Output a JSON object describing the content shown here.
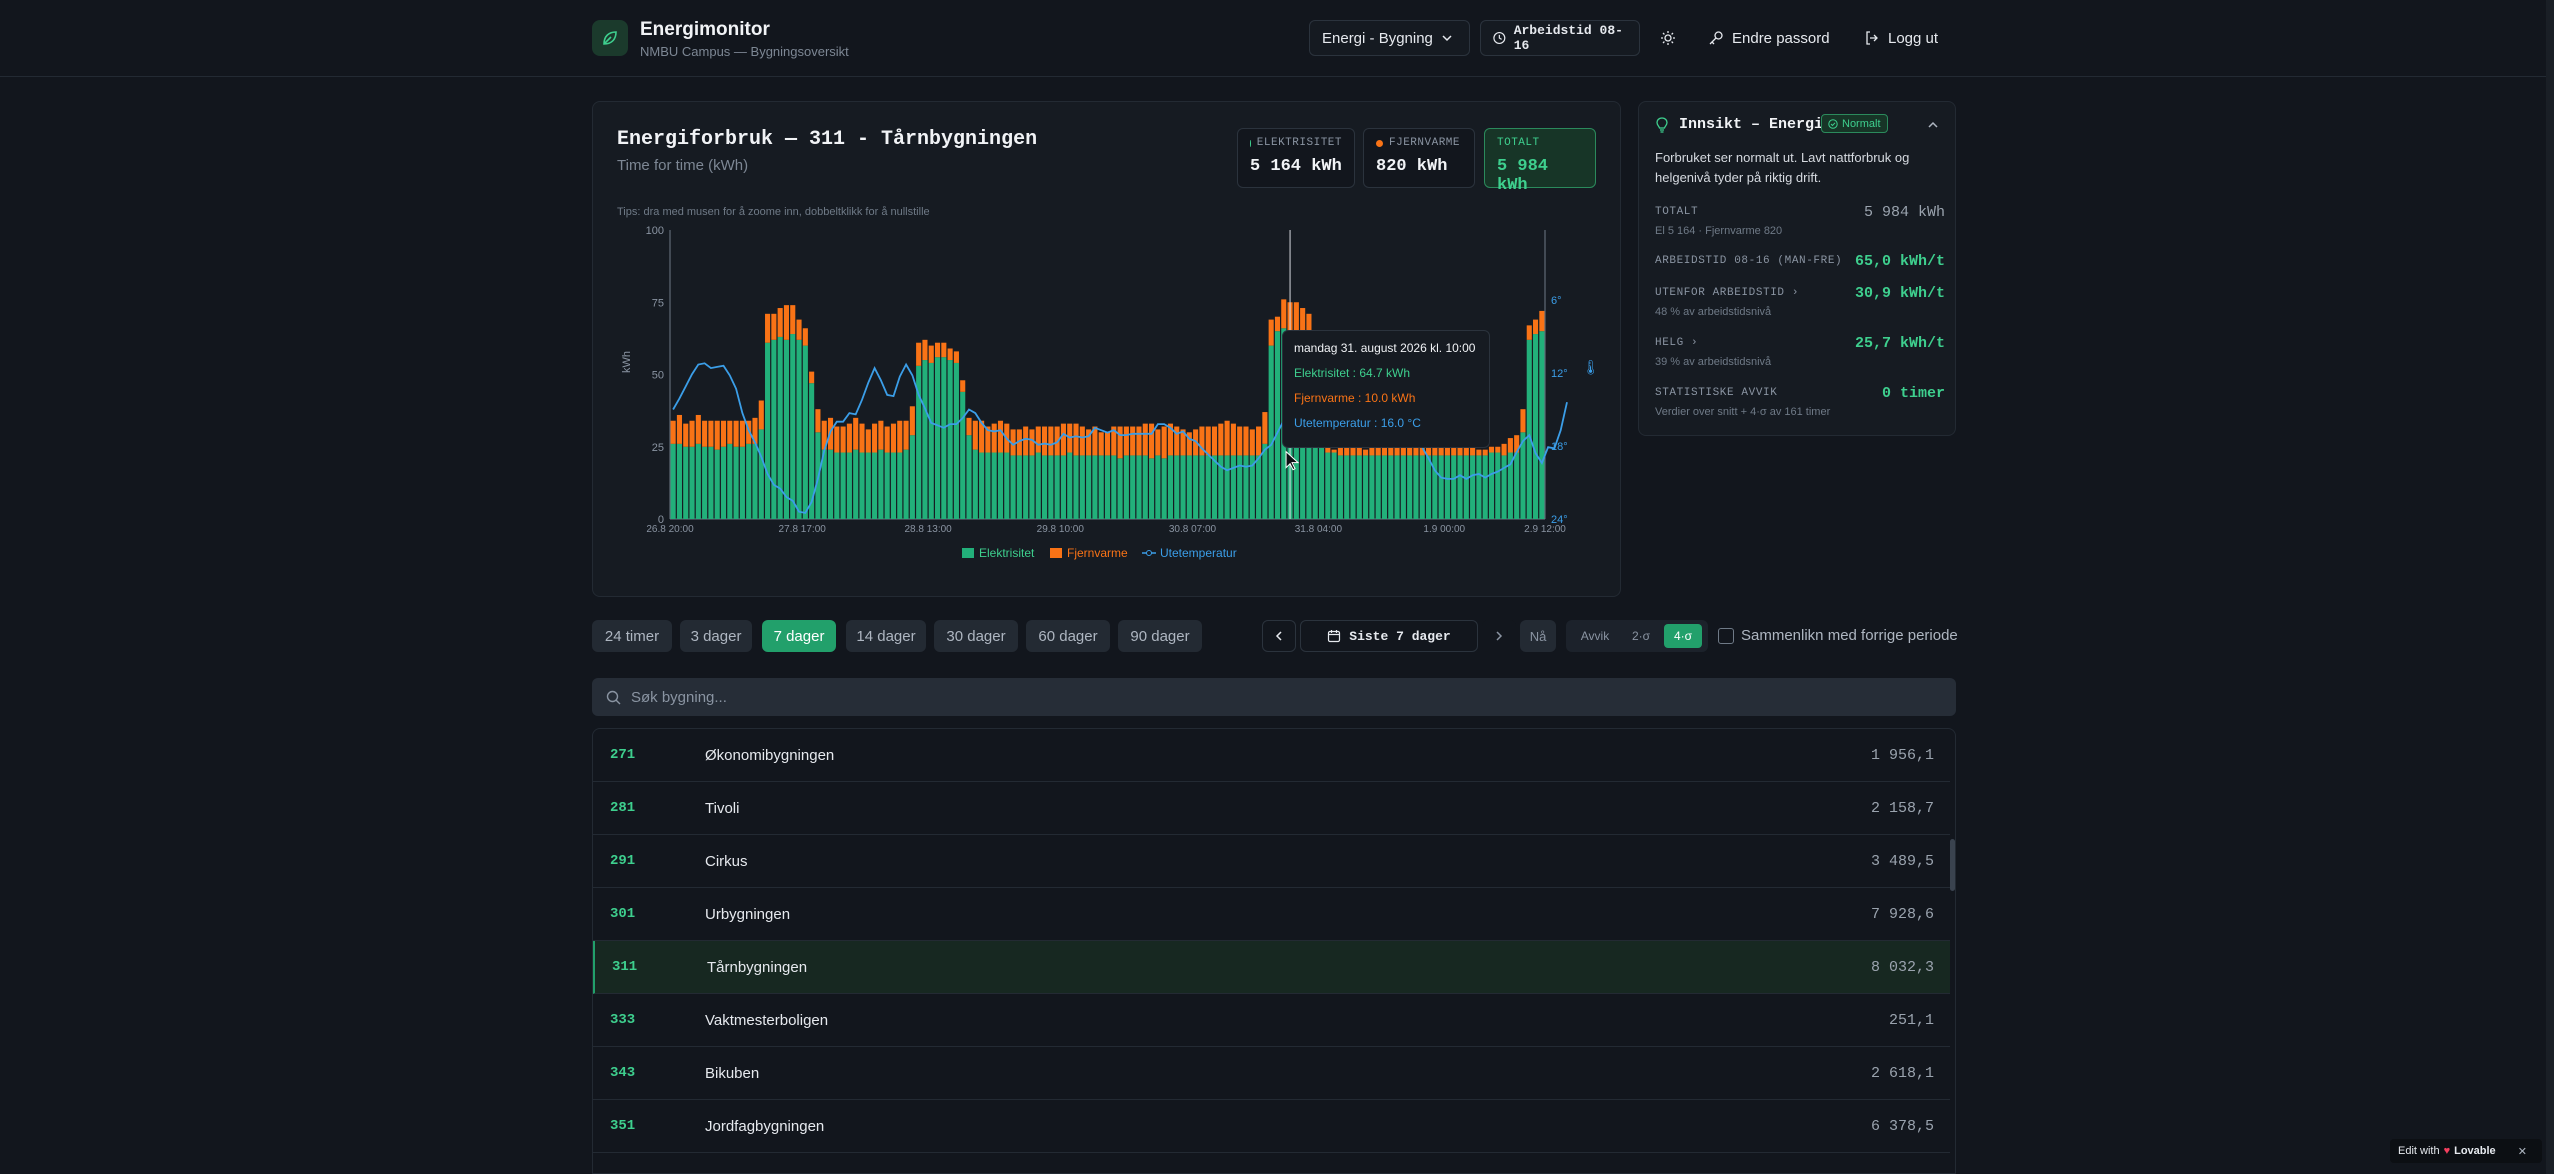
{
  "app": {
    "title": "Energimonitor",
    "subtitle": "NMBU Campus — Bygningsoversikt"
  },
  "header": {
    "view_select": "Energi - Bygning",
    "worktime": "Arbeidstid 08-16",
    "change_password": "Endre passord",
    "logout": "Logg ut"
  },
  "chart_card": {
    "title": "Energiforbruk — 311 - Tårnbygningen",
    "subtitle": "Time for time (kWh)",
    "tip": "Tips: dra med musen for å zoome inn, dobbeltklikk for å nullstille",
    "kpis": [
      {
        "label": "ELEKTRISITET",
        "value": "5 164 kWh",
        "color": "#3ecf8e"
      },
      {
        "label": "FJERNVARME",
        "value": "820 kWh",
        "color": "#f97316"
      },
      {
        "label": "TOTALT",
        "value": "5 984 kWh",
        "color": "#3ecf8e"
      }
    ]
  },
  "tooltip": {
    "title": "mandag 31. august 2026 kl. 10:00",
    "el": "Elektrisitet : 64.7 kWh",
    "fv": "Fjernvarme : 10.0 kWh",
    "temp": "Utetemperatur : 16.0 °C"
  },
  "chart_data": {
    "type": "bar",
    "ylabel": "kWh",
    "ylim": [
      0,
      100
    ],
    "y_ticks": [
      "0",
      "25",
      "50",
      "75",
      "100"
    ],
    "y2_ticks": [
      "6°",
      "12°",
      "18°",
      "24°"
    ],
    "y2_range": [
      6,
      24
    ],
    "y2_reversed": true,
    "x_tick_labels": [
      "26.8 20:00",
      "27.8 17:00",
      "28.8 13:00",
      "29.8 10:00",
      "30.8 07:00",
      "31.8 04:00",
      "1.9 00:00",
      "2.9 12:00"
    ],
    "legend": [
      "Elektrisitet",
      "Fjernvarme",
      "Utetemperatur"
    ],
    "colors": {
      "el": "#22b07a",
      "fv": "#f97316",
      "temp": "#3b9ee8"
    },
    "hover_index": 98,
    "series": [
      {
        "name": "Elektrisitet",
        "values": [
          26,
          26,
          25,
          25,
          26,
          25,
          25,
          24,
          25,
          26,
          25,
          25,
          26,
          26,
          31,
          61,
          62,
          63,
          62,
          64,
          62,
          60,
          47,
          30,
          24,
          24,
          23,
          23,
          23,
          24,
          23,
          23,
          23,
          24,
          23,
          23,
          23,
          24,
          29,
          53,
          55,
          54,
          56,
          56,
          55,
          54,
          44,
          29,
          24,
          23,
          23,
          23,
          23,
          23,
          22,
          22,
          22,
          22,
          23,
          22,
          22,
          22,
          22,
          23,
          22,
          22,
          22,
          22,
          22,
          22,
          22,
          21,
          22,
          22,
          22,
          22,
          21,
          22,
          21,
          22,
          22,
          22,
          22,
          22,
          22,
          22,
          22,
          22,
          22,
          22,
          22,
          22,
          22,
          22,
          26,
          60,
          65,
          66,
          65,
          64,
          63,
          62,
          47,
          28,
          23,
          23,
          22,
          22,
          22,
          22,
          22,
          22,
          22,
          22,
          22,
          22,
          22,
          22,
          22,
          22,
          22,
          22,
          22,
          22,
          22,
          22,
          22,
          22,
          22,
          22,
          23,
          23,
          22,
          23,
          23,
          30,
          62,
          64,
          65
        ]
      },
      {
        "name": "Fjernvarme",
        "values": [
          8,
          10,
          8,
          9,
          10,
          9,
          9,
          10,
          9,
          8,
          9,
          9,
          8,
          9,
          10,
          10,
          9,
          10,
          12,
          10,
          7,
          6,
          4,
          8,
          10,
          11,
          9,
          9,
          10,
          11,
          10,
          8,
          10,
          10,
          9,
          10,
          11,
          10,
          10,
          8,
          7,
          6,
          5,
          5,
          4,
          4,
          4,
          6,
          10,
          11,
          9,
          10,
          11,
          10,
          9,
          9,
          10,
          9,
          9,
          10,
          10,
          10,
          11,
          10,
          11,
          10,
          9,
          10,
          8,
          8,
          10,
          11,
          10,
          10,
          10,
          11,
          12,
          9,
          11,
          11,
          10,
          9,
          8,
          9,
          10,
          10,
          10,
          11,
          12,
          11,
          10,
          10,
          9,
          10,
          11,
          9,
          5,
          10,
          10,
          11,
          10,
          9,
          9,
          8,
          4,
          1,
          3,
          3,
          3,
          3,
          2,
          3,
          4,
          5,
          8,
          6,
          11,
          16,
          17,
          14,
          5,
          5,
          4,
          4,
          3,
          3,
          3,
          3,
          2,
          2,
          2,
          2,
          4,
          5,
          6,
          8,
          5,
          5,
          7
        ]
      },
      {
        "name": "Utetemperatur",
        "values": [
          15,
          14.1,
          13.1,
          12.1,
          11.3,
          11.2,
          11.6,
          11.5,
          11.4,
          12.2,
          13.3,
          15.3,
          16.7,
          17.7,
          18.9,
          20.3,
          21.2,
          21.5,
          22.2,
          22.5,
          23.4,
          23.5,
          22.6,
          20.7,
          18.4,
          16.8,
          16,
          16,
          15.3,
          15.4,
          14.2,
          12.8,
          11.6,
          12.6,
          13.8,
          13.9,
          12.3,
          11.3,
          12.2,
          13.8,
          14.9,
          16.1,
          16.3,
          16.5,
          16.2,
          16.2,
          15.7,
          15,
          15.3,
          16.1,
          16.7,
          16.8,
          16.7,
          17.4,
          17.9,
          17.6,
          17.4,
          17.5,
          17.9,
          17.8,
          17.9,
          17.7,
          17,
          17.3,
          17.2,
          17.3,
          17.2,
          16.5,
          16.7,
          16.9,
          16.7,
          17.1,
          17.1,
          17,
          17,
          17,
          17,
          16.2,
          16.2,
          16.5,
          17,
          16.8,
          17.4,
          17.6,
          18.2,
          18.7,
          19.2,
          19.7,
          20,
          19.8,
          19.6,
          19.7,
          19.6,
          19,
          18.3,
          17.9,
          16.9,
          15.9,
          16,
          17.1,
          17.4,
          17.1,
          17,
          16.8,
          16.8,
          16.9,
          15.8,
          14.6,
          14.5,
          14,
          12.8,
          12.2,
          12.1,
          12.6,
          12.8,
          13.6,
          15.4,
          15.3,
          17.1,
          18.1,
          19,
          20,
          20.6,
          20.7,
          20.7,
          20.4,
          20.7,
          20.4,
          20.3,
          20.6,
          20.3,
          20.1,
          19.8,
          19.5,
          18.5,
          17.6,
          17.1,
          18.6,
          19.4,
          18.1,
          18.2,
          16.7,
          14.4
        ]
      }
    ]
  },
  "insight": {
    "title": "Innsikt – Energi",
    "badge": "Normalt",
    "description": "Forbruket ser normalt ut. Lavt nattforbruk og helgenivå tyder på riktig drift.",
    "rows": [
      {
        "label": "TOTALT",
        "note": "El 5 164 · Fjernvarme 820",
        "value": "5 984 kWh",
        "color": "#9aa3ae"
      },
      {
        "label": "ARBEIDSTID 08-16 (MAN-FRE)",
        "note": "",
        "value": "65,0 kWh/t",
        "color": "#3ecf8e"
      },
      {
        "label": "UTENFOR ARBEIDSTID ›",
        "note": "48 % av arbeidstidsnivå",
        "value": "30,9 kWh/t",
        "color": "#3ecf8e"
      },
      {
        "label": "HELG ›",
        "note": "39 % av arbeidstidsnivå",
        "value": "25,7 kWh/t",
        "color": "#3ecf8e"
      },
      {
        "label": "STATISTISKE AVVIK",
        "note": "Verdier over snitt + 4·σ av 161 timer",
        "value": "0 timer",
        "color": "#3ecf8e"
      }
    ]
  },
  "controls": {
    "ranges": [
      "24 timer",
      "3 dager",
      "7 dager",
      "14 dager",
      "30 dager",
      "60 dager",
      "90 dager"
    ],
    "active_range": "7 dager",
    "period_label": "Siste 7 dager",
    "now": "Nå",
    "avvik": "Avvik",
    "sigma2": "2·σ",
    "sigma4": "4·σ",
    "compare": "Sammenlikn med forrige periode"
  },
  "search": {
    "placeholder": "Søk bygning..."
  },
  "buildings": [
    {
      "num": "271",
      "name": "Økonomibygningen",
      "value": "1 956,1"
    },
    {
      "num": "281",
      "name": "Tivoli",
      "value": "2 158,7"
    },
    {
      "num": "291",
      "name": "Cirkus",
      "value": "3 489,5"
    },
    {
      "num": "301",
      "name": "Urbygningen",
      "value": "7 928,6"
    },
    {
      "num": "311",
      "name": "Tårnbygningen",
      "value": "8 032,3"
    },
    {
      "num": "333",
      "name": "Vaktmesterboligen",
      "value": "251,1"
    },
    {
      "num": "343",
      "name": "Bikuben",
      "value": "2 618,1"
    },
    {
      "num": "351",
      "name": "Jordfagbygningen",
      "value": "6 378,5"
    }
  ],
  "selected_building": "311",
  "lovable": "Edit with",
  "lovable_brand": "Lovable"
}
